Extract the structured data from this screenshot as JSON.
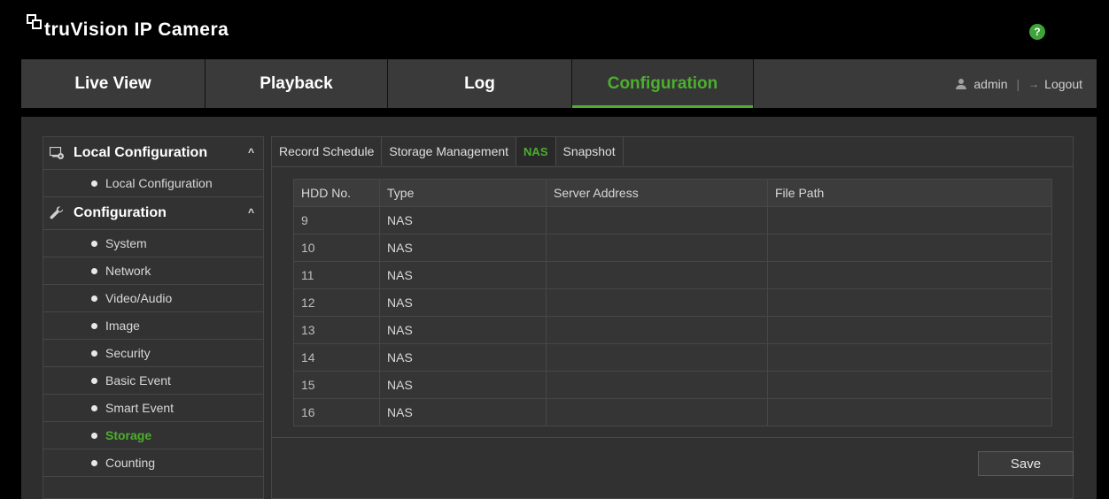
{
  "header": {
    "brand_prefix": "",
    "brand": "truVision IP Camera",
    "help_label": "?"
  },
  "nav": {
    "tabs": [
      {
        "label": "Live View"
      },
      {
        "label": "Playback"
      },
      {
        "label": "Log"
      },
      {
        "label": "Configuration"
      }
    ],
    "active_tab": "Configuration",
    "user": "admin",
    "separator": "|",
    "logout": "Logout"
  },
  "sidebar": {
    "groups": [
      {
        "label": "Local Configuration",
        "icon": "local-config-icon",
        "items": [
          "Local Configuration"
        ]
      },
      {
        "label": "Configuration",
        "icon": "wrench-icon",
        "items": [
          "System",
          "Network",
          "Video/Audio",
          "Image",
          "Security",
          "Basic Event",
          "Smart Event",
          "Storage",
          "Counting"
        ]
      }
    ],
    "active_item": "Storage"
  },
  "subtabs": {
    "items": [
      "Record Schedule",
      "Storage Management",
      "NAS",
      "Snapshot"
    ],
    "active": "NAS"
  },
  "table": {
    "headers": [
      "HDD No.",
      "Type",
      "Server Address",
      "File Path"
    ],
    "rows": [
      [
        "9",
        "NAS",
        "",
        ""
      ],
      [
        "10",
        "NAS",
        "",
        ""
      ],
      [
        "11",
        "NAS",
        "",
        ""
      ],
      [
        "12",
        "NAS",
        "",
        ""
      ],
      [
        "13",
        "NAS",
        "",
        ""
      ],
      [
        "14",
        "NAS",
        "",
        ""
      ],
      [
        "15",
        "NAS",
        "",
        ""
      ],
      [
        "16",
        "NAS",
        "",
        ""
      ]
    ]
  },
  "actions": {
    "save_label": "Save"
  },
  "colors": {
    "accent": "#4caf2d",
    "background": "#000000",
    "panel": "#2e2e2e"
  }
}
